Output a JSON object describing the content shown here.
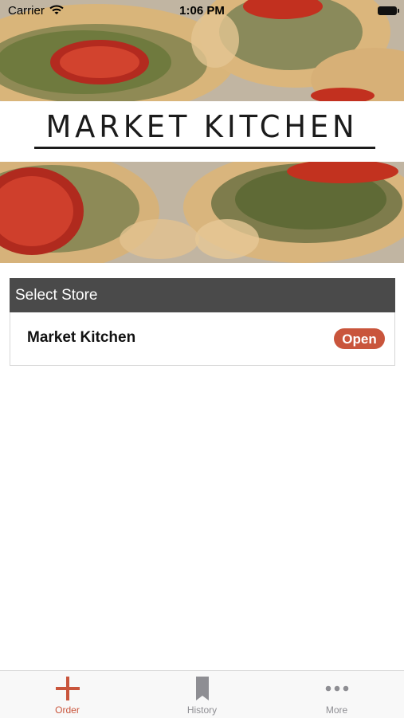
{
  "status_bar": {
    "carrier": "Carrier",
    "time": "1:06 PM"
  },
  "brand": {
    "logo_text": "MARKET KITCHEN"
  },
  "store_select": {
    "header": "Select Store",
    "stores": [
      {
        "name": "Market Kitchen",
        "status": "Open"
      }
    ]
  },
  "tab_bar": {
    "tabs": [
      {
        "label": "Order",
        "icon": "plus-icon",
        "active": true
      },
      {
        "label": "History",
        "icon": "bookmark-icon",
        "active": false
      },
      {
        "label": "More",
        "icon": "more-dots-icon",
        "active": false
      }
    ]
  },
  "colors": {
    "accent": "#c9553c",
    "header_bg": "#4a4a4a",
    "tab_inactive": "#8e8e93",
    "tab_active": "#c9553c"
  }
}
